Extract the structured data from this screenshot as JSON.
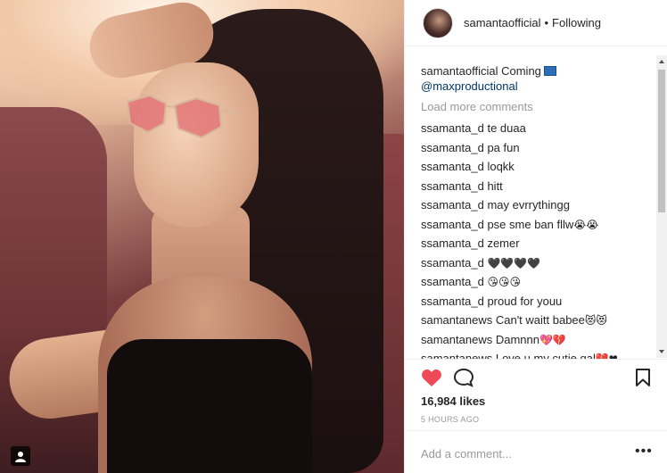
{
  "header": {
    "username": "samantaofficial",
    "separator": "•",
    "follow_status": "Following"
  },
  "caption": {
    "username": "samantaofficial",
    "text": "Coming",
    "mention": "@maxproductional"
  },
  "load_more": "Load more comments",
  "comments": [
    {
      "user": "ssamanta_d",
      "text": "te duaa",
      "emoji": ""
    },
    {
      "user": "ssamanta_d",
      "text": "pa fun",
      "emoji": ""
    },
    {
      "user": "ssamanta_d",
      "text": "loqkk",
      "emoji": ""
    },
    {
      "user": "ssamanta_d",
      "text": "hitt",
      "emoji": ""
    },
    {
      "user": "ssamanta_d",
      "text": "may evrrythingg",
      "emoji": ""
    },
    {
      "user": "ssamanta_d",
      "text": "pse sme ban fllw",
      "emoji": "😭😭"
    },
    {
      "user": "ssamanta_d",
      "text": "zemer",
      "emoji": ""
    },
    {
      "user": "ssamanta_d",
      "text": "",
      "emoji": "🖤🖤🖤🖤"
    },
    {
      "user": "ssamanta_d",
      "text": "",
      "emoji": "😘😘😘"
    },
    {
      "user": "ssamanta_d",
      "text": "proud for youu",
      "emoji": ""
    },
    {
      "user": "samantanews",
      "text": "Can't waitt babee",
      "emoji": "😻😻"
    },
    {
      "user": "samantanews",
      "text": "Damnnn",
      "emoji": "💖💔"
    },
    {
      "user": "samantanews",
      "text": "Love u my cutie gal",
      "emoji": "💔❤"
    }
  ],
  "likes": "16,984 likes",
  "time_ago": "5 HOURS AGO",
  "add_comment": {
    "placeholder": "Add a comment..."
  },
  "more_options": "•••",
  "colors": {
    "heart": "#ed4956",
    "mention": "#003569",
    "muted": "#999999"
  },
  "icons": [
    "heart-icon",
    "comment-icon",
    "bookmark-icon",
    "gallery-icon"
  ]
}
